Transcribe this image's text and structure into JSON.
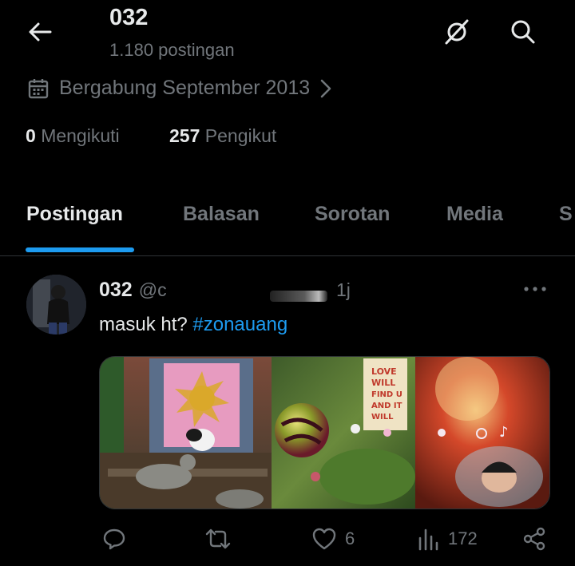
{
  "header": {
    "title": "032",
    "subtitle": "1.180 postingan"
  },
  "profile": {
    "joined": "Bergabung September 2013",
    "following_count": "0",
    "following_label": "Mengikuti",
    "followers_count": "257",
    "followers_label": "Pengikut"
  },
  "tabs": [
    {
      "label": "Postingan",
      "active": true
    },
    {
      "label": "Balasan"
    },
    {
      "label": "Sorotan"
    },
    {
      "label": "Media"
    },
    {
      "label": "S"
    }
  ],
  "post": {
    "name": "032",
    "handle": "@c",
    "time": "1j",
    "text": "masuk ht?",
    "hashtag": "#zonauang",
    "likes": "6",
    "views": "172"
  },
  "colors": {
    "accent": "#1d9bf0",
    "text": "#e7e9ea",
    "muted": "#71767b",
    "divider": "#2f3336"
  },
  "icons": [
    "back-arrow-icon",
    "no-sync-icon",
    "search-icon",
    "calendar-icon",
    "chevron-right-icon",
    "more-icon",
    "reply-icon",
    "repost-icon",
    "like-icon",
    "views-icon",
    "share-icon"
  ]
}
